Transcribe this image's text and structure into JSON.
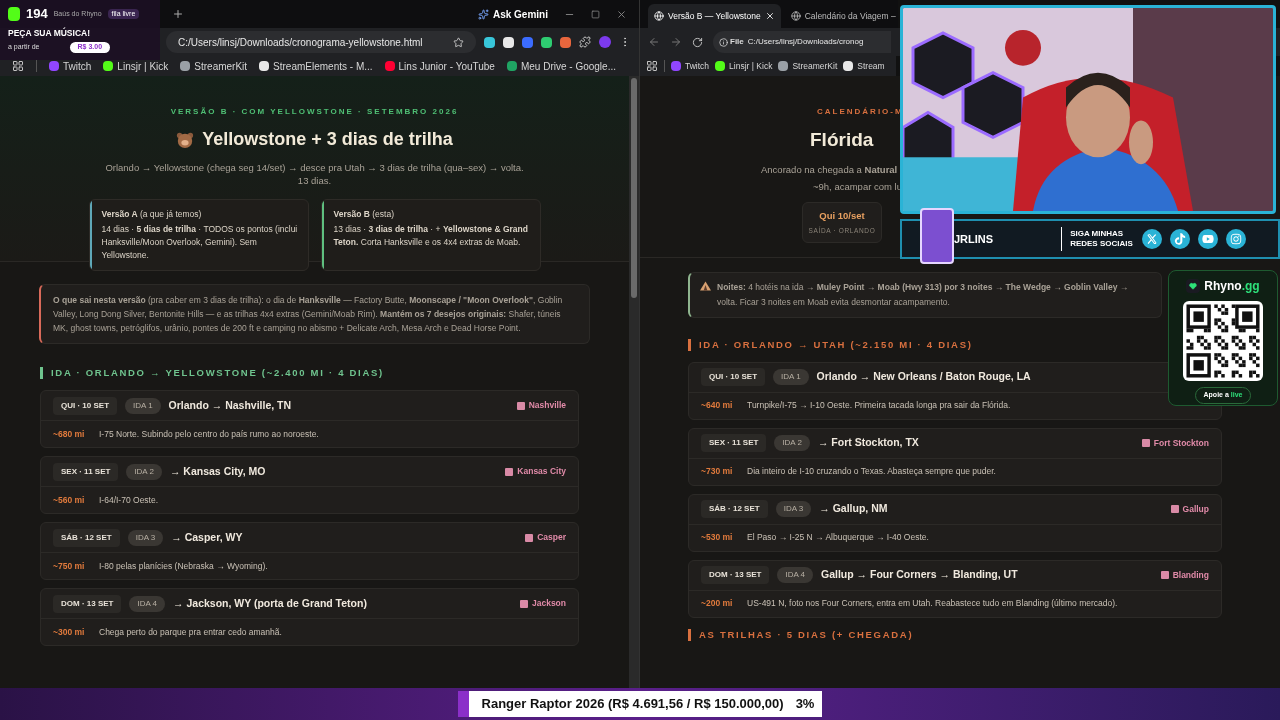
{
  "left_window": {
    "ask_gemini": "Ask Gemini",
    "address": "C:/Users/linsj/Downloads/cronograma-yellowstone.html",
    "bookmarks": [
      {
        "label": "Twitch",
        "color": "#9146ff"
      },
      {
        "label": "Linsjr | Kick",
        "color": "#53fc18"
      },
      {
        "label": "StreamerKit",
        "color": "#9aa0a6"
      },
      {
        "label": "StreamElements - M...",
        "color": "#e8e8e8"
      },
      {
        "label": "Lins Junior - YouTube",
        "color": "#ff0033"
      },
      {
        "label": "Meu Drive - Google...",
        "color": "#1fa463"
      }
    ],
    "page": {
      "eyebrow": "VERSÃO B · COM YELLOWSTONE · SETEMBRO 2026",
      "title": "Yellowstone + 3 dias de trilha",
      "subtitle": "Orlando → Yellowstone (chega seg 14/set) → desce pra Utah → 3 dias de trilha (qua–sex) → volta. 13 dias.",
      "versions": [
        {
          "heading": "**Versão A** (a que já temos)",
          "body": "14 dias · **5 dias de trilha** · TODOS os pontos (inclui Hanksville/Moon Overlook, Gemini). Sem Yellowstone.",
          "color": "#5fa8b8"
        },
        {
          "heading": "**Versão B** (esta)",
          "body": "13 dias · **3 dias de trilha** · + **Yellowstone & Grand Teton.** Corta Hanksville e os 4x4 extras de Moab.",
          "color": "#5fbf7f"
        }
      ],
      "note": "**O que sai nesta versão** (pra caber em 3 dias de trilha): o dia de **Hanksville** — Factory Butte, **Moonscape / \"Moon Overlook\"**, Goblin Valley, Long Dong Silver, Bentonite Hills — e as trilhas 4x4 extras (Gemini/Moab Rim). **Mantém os 7 desejos originais:** Shafer, túneis MK, ghost towns, petróglifos, urânio, pontes de 200 ft e camping no abismo + Delicate Arch, Mesa Arch e Dead Horse Point.",
      "section": "IDA · ORLANDO → YELLOWSTONE (~2.400 MI · 4 DIAS)",
      "days": [
        {
          "date": "QUI · 10 SET",
          "ida": "IDA 1",
          "title": "Orlando → Nashville, TN",
          "hotel": "Nashville",
          "miles": "~680 mi",
          "detail": "I-75 Norte. Subindo pelo centro do país rumo ao noroeste."
        },
        {
          "date": "SEX · 11 SET",
          "ida": "IDA 2",
          "title": "→ Kansas City, MO",
          "hotel": "Kansas City",
          "miles": "~560 mi",
          "detail": "I-64/I-70 Oeste."
        },
        {
          "date": "SÁB · 12 SET",
          "ida": "IDA 3",
          "title": "→ Casper, WY",
          "hotel": "Casper",
          "miles": "~750 mi",
          "detail": "I-80 pelas planícies (Nebraska → Wyoming)."
        },
        {
          "date": "DOM · 13 SET",
          "ida": "IDA 4",
          "title": "→ Jackson, WY (porta de Grand Teton)",
          "hotel": "Jackson",
          "miles": "~300 mi",
          "detail": "Chega perto do parque pra entrar cedo amanhã."
        }
      ]
    }
  },
  "right_window": {
    "tabs": [
      {
        "label": "Versão B — Yellowstone",
        "selected": true
      },
      {
        "label": "Calendário da Viagem –",
        "selected": false
      }
    ],
    "address": "C:/Users/linsj/Downloads/cronog",
    "file_label": "File",
    "bookmarks": [
      {
        "label": "Twitch",
        "color": "#9146ff"
      },
      {
        "label": "Linsjr | Kick",
        "color": "#53fc18"
      },
      {
        "label": "StreamerKit",
        "color": "#9aa0a6"
      },
      {
        "label": "Stream",
        "color": "#e8e8e8"
      }
    ],
    "page": {
      "eyebrow": "CALENDÁRIO-M",
      "title": "Flórida",
      "subtitle_1": "Ancorado na chegada a **Natural**",
      "subtitle_2": "~9h, acampar com lu",
      "stat": {
        "value": "Qui 10/set",
        "label": "SAÍDA · ORLANDO"
      },
      "nights": [
        "**Noites:** 4 hotéis na ida → **Muley Point → Moab (Hwy 313) por 3 noites → The Wedge → Goblin Valley →**",
        "volta. Ficar 3 noites em Moab evita desmontar acampamento."
      ],
      "section": "IDA · ORLANDO → UTAH (~2.150 MI · 4 DIAS)",
      "days": [
        {
          "date": "QUI · 10 SET",
          "ida": "IDA 1",
          "title": "Orlando → New Orleans / Baton Rouge, LA",
          "miles": "~640 mi",
          "detail": "Turnpike/I-75 → I-10 Oeste. Primeira tacada longa pra sair da Flórida."
        },
        {
          "date": "SEX · 11 SET",
          "ida": "IDA 2",
          "title": "→ Fort Stockton, TX",
          "hotel": "Fort Stockton",
          "miles": "~730 mi",
          "detail": "Dia inteiro de I-10 cruzando o Texas. Abasteça sempre que puder."
        },
        {
          "date": "SÁB · 12 SET",
          "ida": "IDA 3",
          "title": "→ Gallup, NM",
          "hotel": "Gallup",
          "miles": "~530 mi",
          "detail": "El Paso → I-25 N → Albuquerque → I-40 Oeste."
        },
        {
          "date": "DOM · 13 SET",
          "ida": "IDA 4",
          "title": "Gallup → Four Corners → Blanding, UT",
          "hotel": "Blanding",
          "miles": "~200 mi",
          "detail": "US-491 N, foto nos Four Corners, entra em Utah. Reabastece tudo em Blanding (último mercado)."
        }
      ],
      "next_section": "AS TRILHAS · 5 DIAS (+ CHEGADA)"
    }
  },
  "overlay": {
    "viewers": "194",
    "chest": "Baús do Rhyno",
    "queue": "fila livre",
    "song_title": "PEÇA SUA MÚSICA!",
    "price_label": "a partir de",
    "price": "R$ 3.00",
    "channel": "JRLINS",
    "follow": "SIGA MINHAS REDES SOCIAIS",
    "brand": "Rhyno",
    "brand_suffix": ".gg",
    "support": "Apoie a",
    "support_highlight": "live",
    "goal": {
      "text": "Ranger Raptor 2026 (R$ 4.691,56 / R$ 150.000,00)",
      "percent": "3%",
      "level": 0.03
    }
  }
}
